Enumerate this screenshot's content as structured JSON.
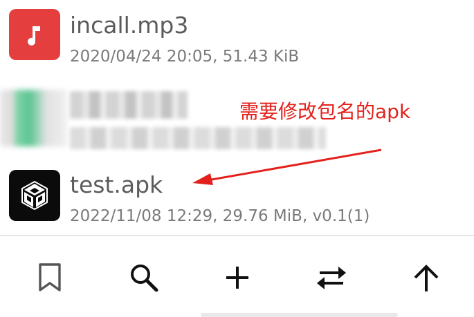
{
  "files": [
    {
      "name": "incall.mp3",
      "meta": "2020/04/24 20:05, 51.43 KiB",
      "icon": "music-note-icon",
      "icon_color": "#e53e3e"
    },
    {
      "icon": "blurred-file-icon"
    },
    {
      "name": "test.apk",
      "meta": "2022/11/08 12:29, 29.76 MiB, v0.1(1)",
      "icon": "unity-logo-icon",
      "icon_color": "#0b0b0b"
    }
  ],
  "annotation": {
    "text": "需要修改包名的apk",
    "color": "#e3211c"
  },
  "toolbar": {
    "buttons": [
      {
        "icon": "bookmark-icon"
      },
      {
        "icon": "search-icon"
      },
      {
        "icon": "plus-icon"
      },
      {
        "icon": "swap-icon"
      },
      {
        "icon": "arrow-up-icon"
      }
    ]
  }
}
